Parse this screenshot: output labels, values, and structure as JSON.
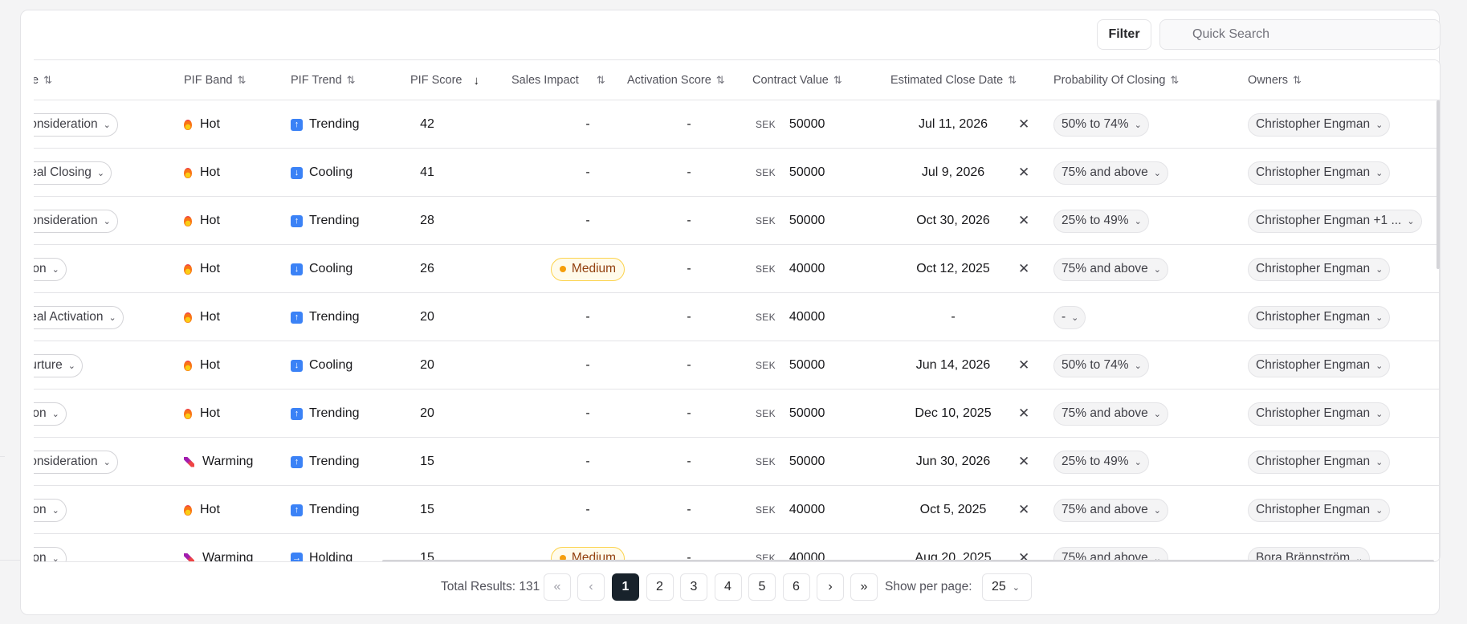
{
  "toolbar": {
    "filter_label": "Filter",
    "search_placeholder": "Quick Search"
  },
  "columns": [
    {
      "label": "e",
      "sort": "sortable"
    },
    {
      "label": "PIF Band",
      "sort": "sortable"
    },
    {
      "label": "PIF Trend",
      "sort": "sortable"
    },
    {
      "label": "PIF Score",
      "sort": "descending"
    },
    {
      "label": "Sales Impact",
      "sort": "sortable"
    },
    {
      "label": "Activation Score",
      "sort": "sortable"
    },
    {
      "label": "Contract Value",
      "sort": "sortable"
    },
    {
      "label": "Estimated Close Date",
      "sort": "sortable"
    },
    {
      "label": "Probability Of Closing",
      "sort": "sortable"
    },
    {
      "label": "Owners",
      "sort": "sortable"
    }
  ],
  "rows": [
    {
      "stage": "Consideration",
      "band": "Hot",
      "band_icon": "fire-icon",
      "trend": "Trending",
      "trend_icon": "arrow-up-icon",
      "score": "42",
      "impact": "-",
      "activation": "-",
      "currency": "SEK",
      "value": "50000",
      "close_date": "Jul 11, 2026",
      "probability": "50% to 74%",
      "owners": "Christopher Engman"
    },
    {
      "stage": "Deal Closing",
      "band": "Hot",
      "band_icon": "fire-icon",
      "trend": "Cooling",
      "trend_icon": "arrow-down-icon",
      "score": "41",
      "impact": "-",
      "activation": "-",
      "currency": "SEK",
      "value": "50000",
      "close_date": "Jul 9, 2026",
      "probability": "75% and above",
      "owners": "Christopher Engman"
    },
    {
      "stage": "Consideration",
      "band": "Hot",
      "band_icon": "fire-icon",
      "trend": "Trending",
      "trend_icon": "arrow-up-icon",
      "score": "28",
      "impact": "-",
      "activation": "-",
      "currency": "SEK",
      "value": "50000",
      "close_date": "Oct 30, 2026",
      "probability": "25% to 49%",
      "owners": "Christopher Engman +1 ..."
    },
    {
      "stage": "Won",
      "band": "Hot",
      "band_icon": "fire-icon",
      "trend": "Cooling",
      "trend_icon": "arrow-down-icon",
      "score": "26",
      "impact": "Medium",
      "activation": "-",
      "currency": "SEK",
      "value": "40000",
      "close_date": "Oct 12, 2025",
      "probability": "75% and above",
      "owners": "Christopher Engman"
    },
    {
      "stage": "Deal Activation",
      "band": "Hot",
      "band_icon": "fire-icon",
      "trend": "Trending",
      "trend_icon": "arrow-up-icon",
      "score": "20",
      "impact": "-",
      "activation": "-",
      "currency": "SEK",
      "value": "40000",
      "close_date": "-",
      "probability": "-",
      "owners": "Christopher Engman"
    },
    {
      "stage": "Nurture",
      "band": "Hot",
      "band_icon": "fire-icon",
      "trend": "Cooling",
      "trend_icon": "arrow-down-icon",
      "score": "20",
      "impact": "-",
      "activation": "-",
      "currency": "SEK",
      "value": "50000",
      "close_date": "Jun 14, 2026",
      "probability": "50% to 74%",
      "owners": "Christopher Engman"
    },
    {
      "stage": "Won",
      "band": "Hot",
      "band_icon": "fire-icon",
      "trend": "Trending",
      "trend_icon": "arrow-up-icon",
      "score": "20",
      "impact": "-",
      "activation": "-",
      "currency": "SEK",
      "value": "50000",
      "close_date": "Dec 10, 2025",
      "probability": "75% and above",
      "owners": "Christopher Engman"
    },
    {
      "stage": "Consideration",
      "band": "Warming",
      "band_icon": "warming-icon",
      "trend": "Trending",
      "trend_icon": "arrow-up-icon",
      "score": "15",
      "impact": "-",
      "activation": "-",
      "currency": "SEK",
      "value": "50000",
      "close_date": "Jun 30, 2026",
      "probability": "25% to 49%",
      "owners": "Christopher Engman"
    },
    {
      "stage": "Won",
      "band": "Hot",
      "band_icon": "fire-icon",
      "trend": "Trending",
      "trend_icon": "arrow-up-icon",
      "score": "15",
      "impact": "-",
      "activation": "-",
      "currency": "SEK",
      "value": "40000",
      "close_date": "Oct 5, 2025",
      "probability": "75% and above",
      "owners": "Christopher Engman"
    },
    {
      "stage": "Won",
      "band": "Warming",
      "band_icon": "warming-icon",
      "trend": "Holding",
      "trend_icon": "arrow-right-icon",
      "score": "15",
      "impact": "Medium",
      "activation": "-",
      "currency": "SEK",
      "value": "40000",
      "close_date": "Aug 20, 2025",
      "probability": "75% and above",
      "owners": "Bora Brännström"
    }
  ],
  "pagination": {
    "total_label": "Total Results: 131",
    "pages": [
      "1",
      "2",
      "3",
      "4",
      "5",
      "6"
    ],
    "current_page": "1",
    "per_page_label": "Show per page:",
    "per_page_value": "25"
  },
  "colors": {
    "active_page": "#18222b",
    "trend_icon_bg": "#3b82f6",
    "medium_badge_bg": "#fffbeb",
    "medium_badge_border": "#fcd34d"
  }
}
